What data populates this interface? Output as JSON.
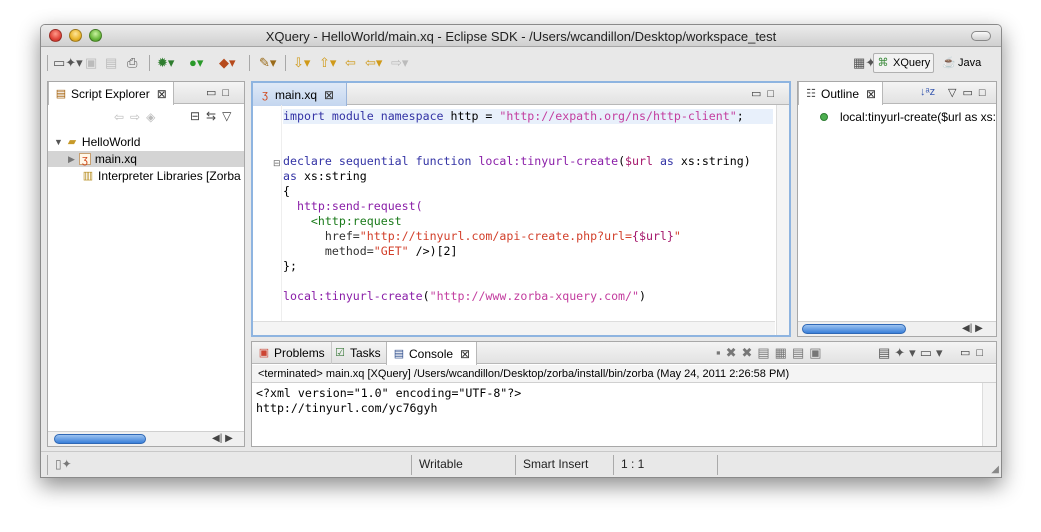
{
  "window": {
    "title": "XQuery - HelloWorld/main.xq - Eclipse SDK - /Users/wcandillon/Desktop/workspace_test"
  },
  "perspectives": {
    "xquery": "XQuery",
    "java": "Java"
  },
  "explorer": {
    "tab_label": "Script Explorer",
    "items": [
      {
        "label": "HelloWorld"
      },
      {
        "label": "main.xq"
      },
      {
        "label": "Interpreter Libraries [Zorba"
      }
    ]
  },
  "editor": {
    "tab_label": "main.xq",
    "lines": {
      "l1a": "import module namespace",
      "l1b": " http = ",
      "l1c": "\"http://expath.org/ns/http-client\"",
      "l1d": ";",
      "l2a": "declare sequential function",
      "l2b": " local:tinyurl-create",
      "l2c": "(",
      "l2d": "$url",
      "l2e": " as",
      "l2f": " xs:string)",
      "l3a": "as",
      "l3b": " xs:string",
      "l4": "{",
      "l5": "  http:send-request(",
      "l6a": "    <",
      "l6b": "http:request",
      "l7a": "      href=",
      "l7b": "\"http://tinyurl.com/api-create.php?url=",
      "l7c": "{$url}",
      "l7d": "\"",
      "l8a": "      method=",
      "l8b": "\"GET\"",
      "l8c": " />)[2]",
      "l9": "};",
      "l10a": "local:tinyurl-create",
      "l10b": "(",
      "l10c": "\"http://www.zorba-xquery.com/\"",
      "l10d": ")"
    }
  },
  "outline": {
    "tab_label": "Outline",
    "items": [
      {
        "label": "local:tinyurl-create($url as xs:"
      }
    ]
  },
  "bottom": {
    "tabs": {
      "problems": "Problems",
      "tasks": "Tasks",
      "console": "Console"
    },
    "console_header": "<terminated> main.xq [XQuery] /Users/wcandillon/Desktop/zorba/install/bin/zorba (May 24, 2011 2:26:58 PM)",
    "console_lines": [
      "<?xml version=\"1.0\" encoding=\"UTF-8\"?>",
      "http://tinyurl.com/yc76gyh"
    ]
  },
  "status": {
    "writable": "Writable",
    "insert_mode": "Smart Insert",
    "position": "1 : 1"
  },
  "colors": {
    "active_border": "#8eb4e0",
    "keyword": "#3333a5",
    "string": "#c33d9f",
    "tag": "#1a7a1a"
  }
}
